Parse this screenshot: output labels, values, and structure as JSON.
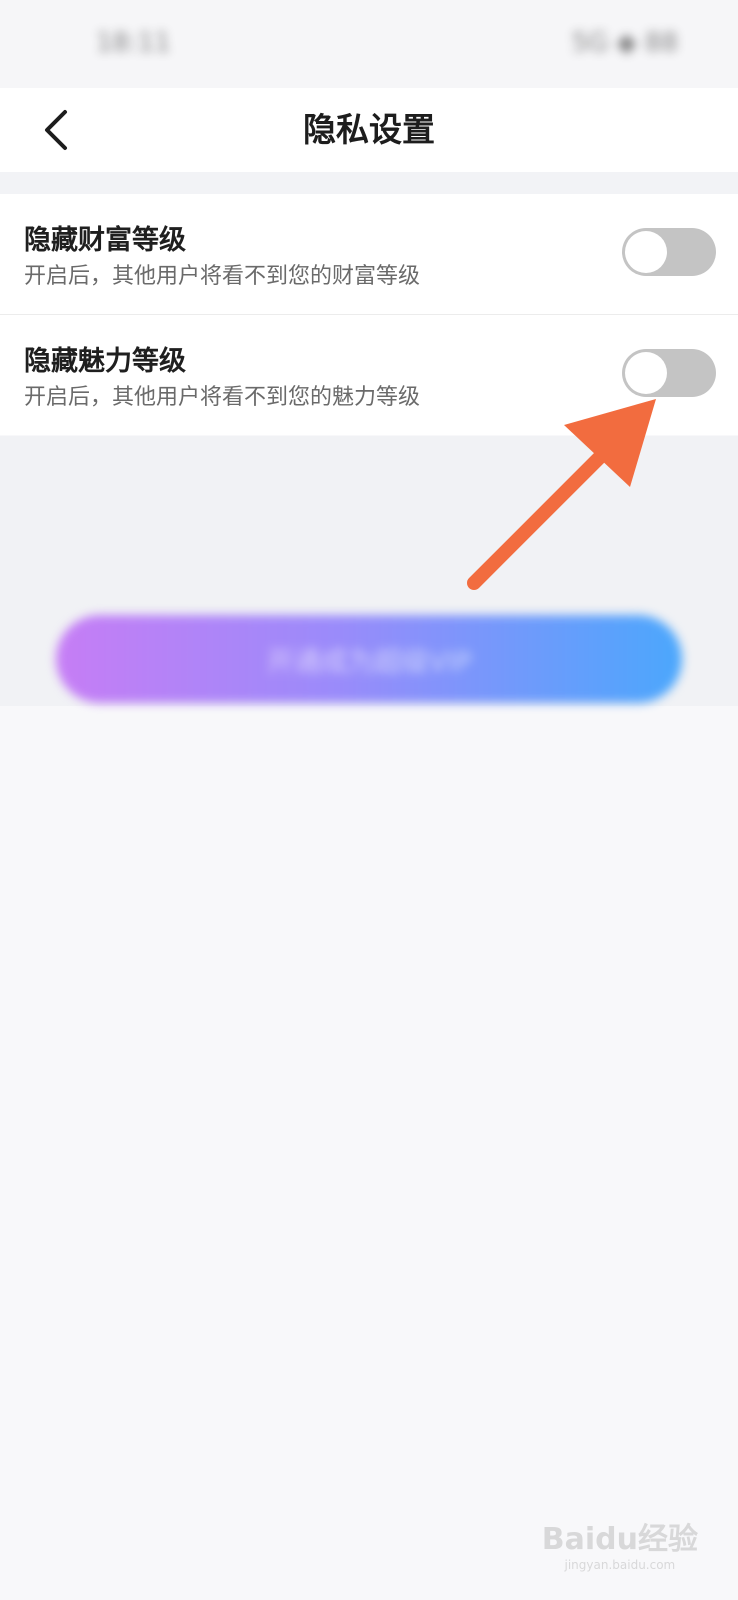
{
  "status_bar": {
    "time": "18:11",
    "icons": "5G ◆ 88"
  },
  "nav": {
    "title": "隐私设置",
    "back_icon": "chevron-left-icon"
  },
  "settings": [
    {
      "title": "隐藏财富等级",
      "description": "开启后，其他用户将看不到您的财富等级",
      "enabled": false
    },
    {
      "title": "隐藏魅力等级",
      "description": "开启后，其他用户将看不到您的魅力等级",
      "enabled": false
    }
  ],
  "vip_button": {
    "label": "开通成为超级VIP"
  },
  "annotation": {
    "color": "#f26c3f"
  },
  "watermark": {
    "brand": "Baidu经验",
    "url": "jingyan.baidu.com"
  }
}
